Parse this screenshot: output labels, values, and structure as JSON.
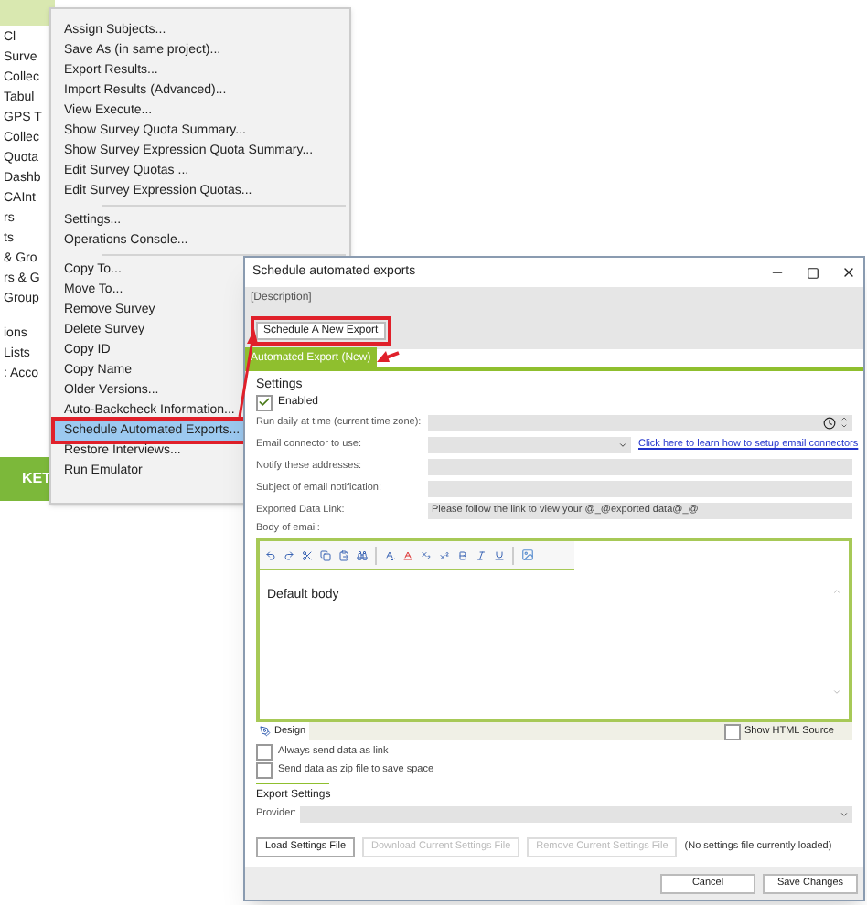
{
  "background_app": {
    "nav_items": [
      "Cl",
      "Surve",
      "Collec",
      "Tabul",
      "GPS T",
      "Collec",
      "Quota",
      "Dashb",
      "CAInt",
      "rs",
      "ts",
      "& Gro",
      "rs & G",
      "Group",
      "ions",
      "Lists",
      ": Acco"
    ],
    "banner": "KET"
  },
  "context_menu": {
    "groups": [
      {
        "items": [
          {
            "label": "Assign Subjects...",
            "selected": false
          },
          {
            "label": "Save As (in same project)...",
            "selected": false
          },
          {
            "label": "Export Results...",
            "selected": false
          },
          {
            "label": "Import Results (Advanced)...",
            "selected": false
          },
          {
            "label": "View Execute...",
            "selected": false
          },
          {
            "label": "Show Survey Quota Summary...",
            "selected": false
          },
          {
            "label": "Show Survey Expression Quota Summary...",
            "selected": false
          },
          {
            "label": "Edit Survey Quotas ...",
            "selected": false
          },
          {
            "label": "Edit Survey Expression Quotas...",
            "selected": false
          }
        ]
      },
      {
        "items": [
          {
            "label": "Settings...",
            "selected": false
          },
          {
            "label": "Operations Console...",
            "selected": false
          }
        ]
      },
      {
        "items": [
          {
            "label": "Copy To...",
            "selected": false
          },
          {
            "label": "Move To...",
            "selected": false
          },
          {
            "label": "Remove Survey",
            "selected": false
          },
          {
            "label": "Delete Survey",
            "selected": false
          },
          {
            "label": "Copy ID",
            "selected": false
          },
          {
            "label": "Copy Name",
            "selected": false
          },
          {
            "label": "Older Versions...",
            "selected": false
          },
          {
            "label": "Auto-Backcheck Information...",
            "selected": false
          },
          {
            "label": "Schedule Automated Exports...",
            "selected": true
          },
          {
            "label": "Restore Interviews...",
            "selected": false
          },
          {
            "label": "Run Emulator",
            "selected": false
          }
        ]
      }
    ]
  },
  "dialog": {
    "title": "Schedule automated exports",
    "description": "[Description]",
    "new_export_button": "Schedule A New Export",
    "tabs": [
      {
        "label": "Automated Export (New)",
        "selected": true
      }
    ],
    "settings": {
      "heading": "Settings",
      "enabled": {
        "label": "Enabled",
        "checked": true
      },
      "fields": [
        {
          "kind": "time",
          "label": "Run daily at time (current time zone):"
        },
        {
          "kind": "select",
          "label": "Email connector to use:",
          "link": "Click here to learn how to setup email connectors"
        },
        {
          "kind": "text",
          "label": "Notify these addresses:"
        },
        {
          "kind": "text",
          "label": "Subject of email notification:"
        },
        {
          "kind": "text",
          "label": "Exported Data Link:",
          "value": "Please follow the link to view your @_@exported data@_@"
        }
      ]
    },
    "body_label": "Body of email:",
    "editor": {
      "body": "Default body",
      "mode_tab": "Design",
      "show_html_source": {
        "label": "Show HTML Source",
        "checked": false
      }
    },
    "options": [
      {
        "label": "Always send data as link",
        "checked": false
      },
      {
        "label": "Send data as zip file to save space",
        "checked": false
      }
    ],
    "export_settings": {
      "heading": "Export Settings",
      "provider_label": "Provider:",
      "buttons": [
        {
          "label": "Load Settings File",
          "disabled": false
        },
        {
          "label": "Download Current Settings File",
          "disabled": true
        },
        {
          "label": "Remove Current Settings File",
          "disabled": true
        }
      ],
      "status": "(No settings file currently loaded)"
    },
    "footer_buttons": [
      "Cancel",
      "Save Changes"
    ]
  }
}
